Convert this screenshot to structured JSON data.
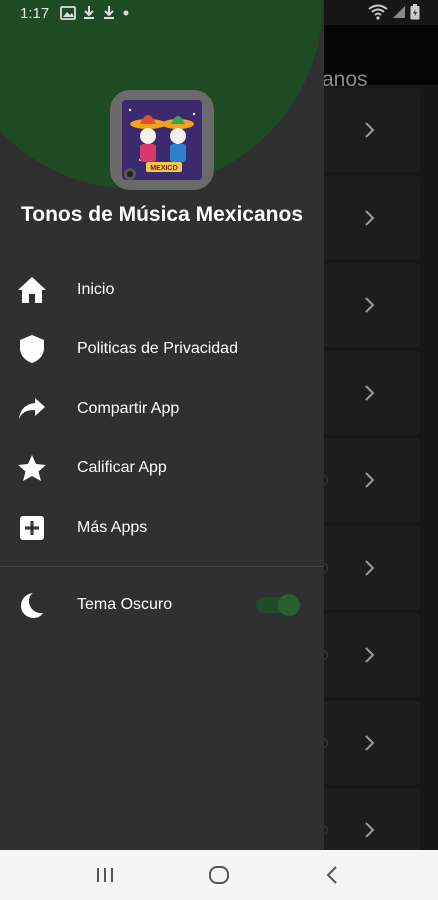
{
  "status_bar": {
    "time": "1:17",
    "left_icons": [
      "image-icon",
      "download-icon",
      "download-icon",
      "dot-icon"
    ],
    "right_icons": [
      "wifi-icon",
      "signal-icon",
      "battery-icon"
    ]
  },
  "background_app": {
    "title_fragment": "anos",
    "rows": 9
  },
  "drawer": {
    "header_title": "Tonos de Música Mexicanos",
    "logo_text": "MEXICO",
    "menu": [
      {
        "label": "Inicio",
        "icon": "home-icon"
      },
      {
        "label": "Politicas de Privacidad",
        "icon": "shield-icon"
      },
      {
        "label": "Compartir App",
        "icon": "share-icon"
      },
      {
        "label": "Calificar App",
        "icon": "star-icon"
      },
      {
        "label": "Más Apps",
        "icon": "plus-box-icon"
      }
    ],
    "dark_theme": {
      "label": "Tema Oscuro",
      "icon": "moon-icon",
      "enabled": true
    }
  },
  "colors": {
    "drawer_bg": "#303030",
    "header_accent": "#1e4b24",
    "toggle_track": "#1f4b25"
  }
}
